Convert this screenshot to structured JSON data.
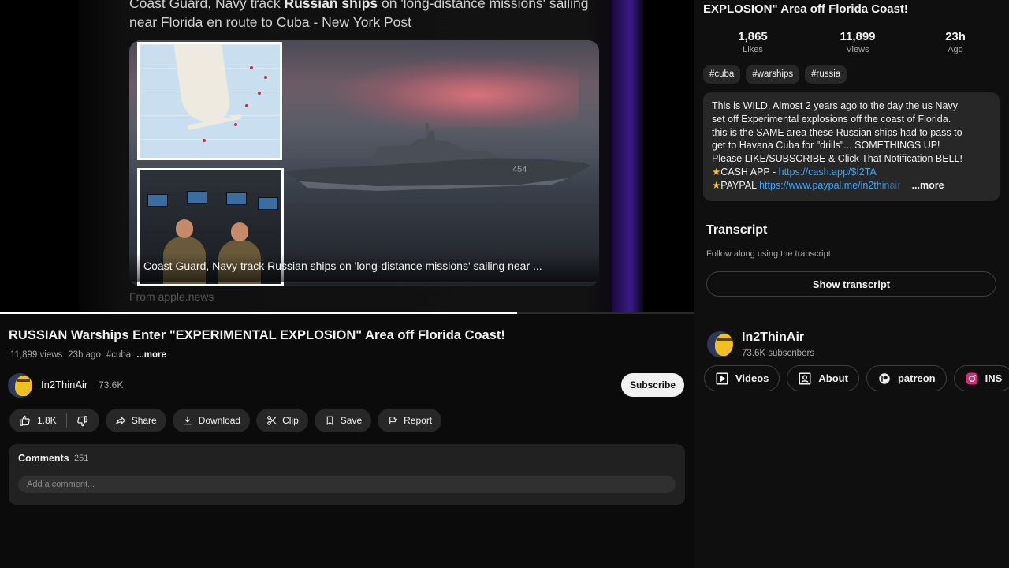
{
  "video": {
    "headline_plain_1": "Coast Guard, Navy track ",
    "headline_bold": "Russian ships",
    "headline_plain_2": " on 'long-distance missions' sailing near Florida en route to Cuba - New York Post",
    "card_caption": "Coast Guard, Navy track Russian ships on 'long-distance missions' sailing near ...",
    "ship_hull_number": "454",
    "source": "From apple.news",
    "progress_fraction": 0.746
  },
  "title": "RUSSIAN Warships Enter \"EXPERIMENTAL EXPLOSION\" Area off Florida Coast!",
  "meta": {
    "views": "11,899 views",
    "time": "23h ago",
    "tag": "#cuba",
    "more": "...more"
  },
  "channel": {
    "name": "In2ThinAir",
    "subs_short": "73.6K",
    "subscribe_label": "Subscribe"
  },
  "actions": {
    "likes": "1.8K",
    "share": "Share",
    "download": "Download",
    "clip": "Clip",
    "save": "Save",
    "report": "Report"
  },
  "comments": {
    "title": "Comments",
    "count": "251",
    "placeholder": "Add a comment..."
  },
  "side": {
    "title": "EXPLOSION\" Area off Florida Coast!",
    "stats": [
      {
        "num": "1,865",
        "label": "Likes"
      },
      {
        "num": "11,899",
        "label": "Views"
      },
      {
        "num": "23h",
        "label": "Ago"
      }
    ],
    "tags": [
      "#cuba",
      "#warships",
      "#russia"
    ],
    "description": {
      "line1": "This is WILD, Almost 2 years ago to the day the us Navy",
      "line2": "set off Experimental explosions off the coast of Florida.",
      "line3": "this is the SAME area these Russian ships had to pass to",
      "line4": "get to Havana Cuba for \"drills\"... SOMETHINGS UP!",
      "line5": "Please LIKE/SUBSCRIBE & Click That Notification BELL!",
      "cash_label": "CASH APP - ",
      "cash_link": "https://cash.app/$I2TA",
      "paypal_label": "PAYPAL ",
      "paypal_link": "https://www.paypal.me/in2thinair",
      "more": "...more"
    },
    "transcript": {
      "title": "Transcript",
      "subtitle": "Follow along using the transcript.",
      "button": "Show transcript"
    },
    "channel": {
      "name": "In2ThinAir",
      "subs": "73.6K subscribers",
      "tabs": [
        "Videos",
        "About",
        "patreon",
        "INS"
      ]
    }
  },
  "icons": {
    "like": "thumbs-up-icon",
    "dislike": "thumbs-down-icon",
    "share": "share-arrow-icon",
    "download": "download-icon",
    "clip": "scissors-icon",
    "save": "bookmark-icon",
    "report": "flag-icon",
    "videos": "play-box-icon",
    "about": "person-box-icon",
    "patreon": "patreon-icon",
    "instagram": "instagram-icon"
  },
  "colors": {
    "background": "#0f0f0f",
    "pill": "#272727",
    "link": "#3ea6ff",
    "subscribe_bg": "#f1f1f1",
    "instagram": "#d62976",
    "star": "#f5c518"
  }
}
